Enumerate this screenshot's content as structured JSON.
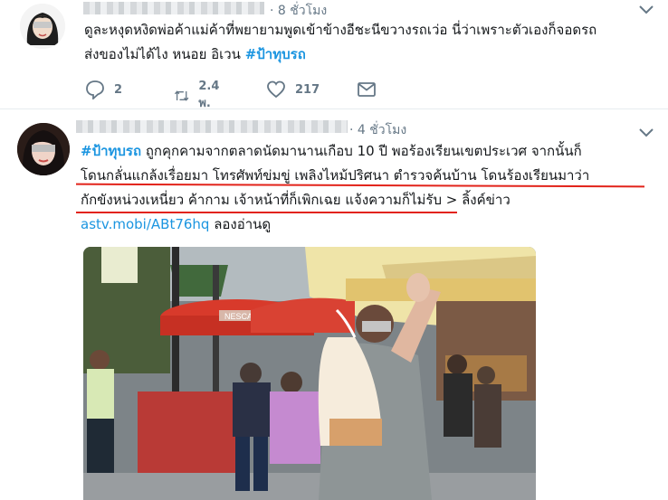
{
  "tweets": [
    {
      "timestamp": "8 ชั่วโมง",
      "text_line1": "ดูละหงุดหงิดพ่อค้าแม่ค้าที่พยายามพูดเข้าข้างอีชะนีขวางรถเว่อ นี่ว่าเพราะตัวเองก็จอดรถ",
      "text_line2_a": "ส่งของไม่ได้ไง หนอย อิเวน ",
      "hashtag": "#ป้าทุบรถ",
      "replies": "2",
      "retweets": "2.4 พ.",
      "likes": "217"
    },
    {
      "timestamp": "4 ชั่วโมง",
      "hashtag": "#ป้าทุบรถ",
      "text_line1_rest": " ถูกคุกคามจากตลาดนัดมานานเกือบ 10 ปี พอร้องเรียนเขตประเวศ จากนั้นก็",
      "text_line2": "โดนกลั่นแกล้งเรื่อยมา โทรศัพท์ข่มขู่ เพลิงไหม้ปริศนา ตำรวจค้นบ้าน โดนร้องเรียนมาว่า",
      "text_line3": "กักขังหน่วงเหนี่ยว ค้ากาม เจ้าหน้าที่ก็เพิกเฉย แจ้งความก็ไม่รับ > ลิ้งค์ข่าว",
      "link": "astv.mobi/ABt76hq",
      "link_after": " ลองอ่านดู",
      "photo_sign": "NESCAFE"
    }
  ],
  "colors": {
    "accent": "#1b95e0",
    "muted": "#657786",
    "underline": "#e2231a"
  }
}
